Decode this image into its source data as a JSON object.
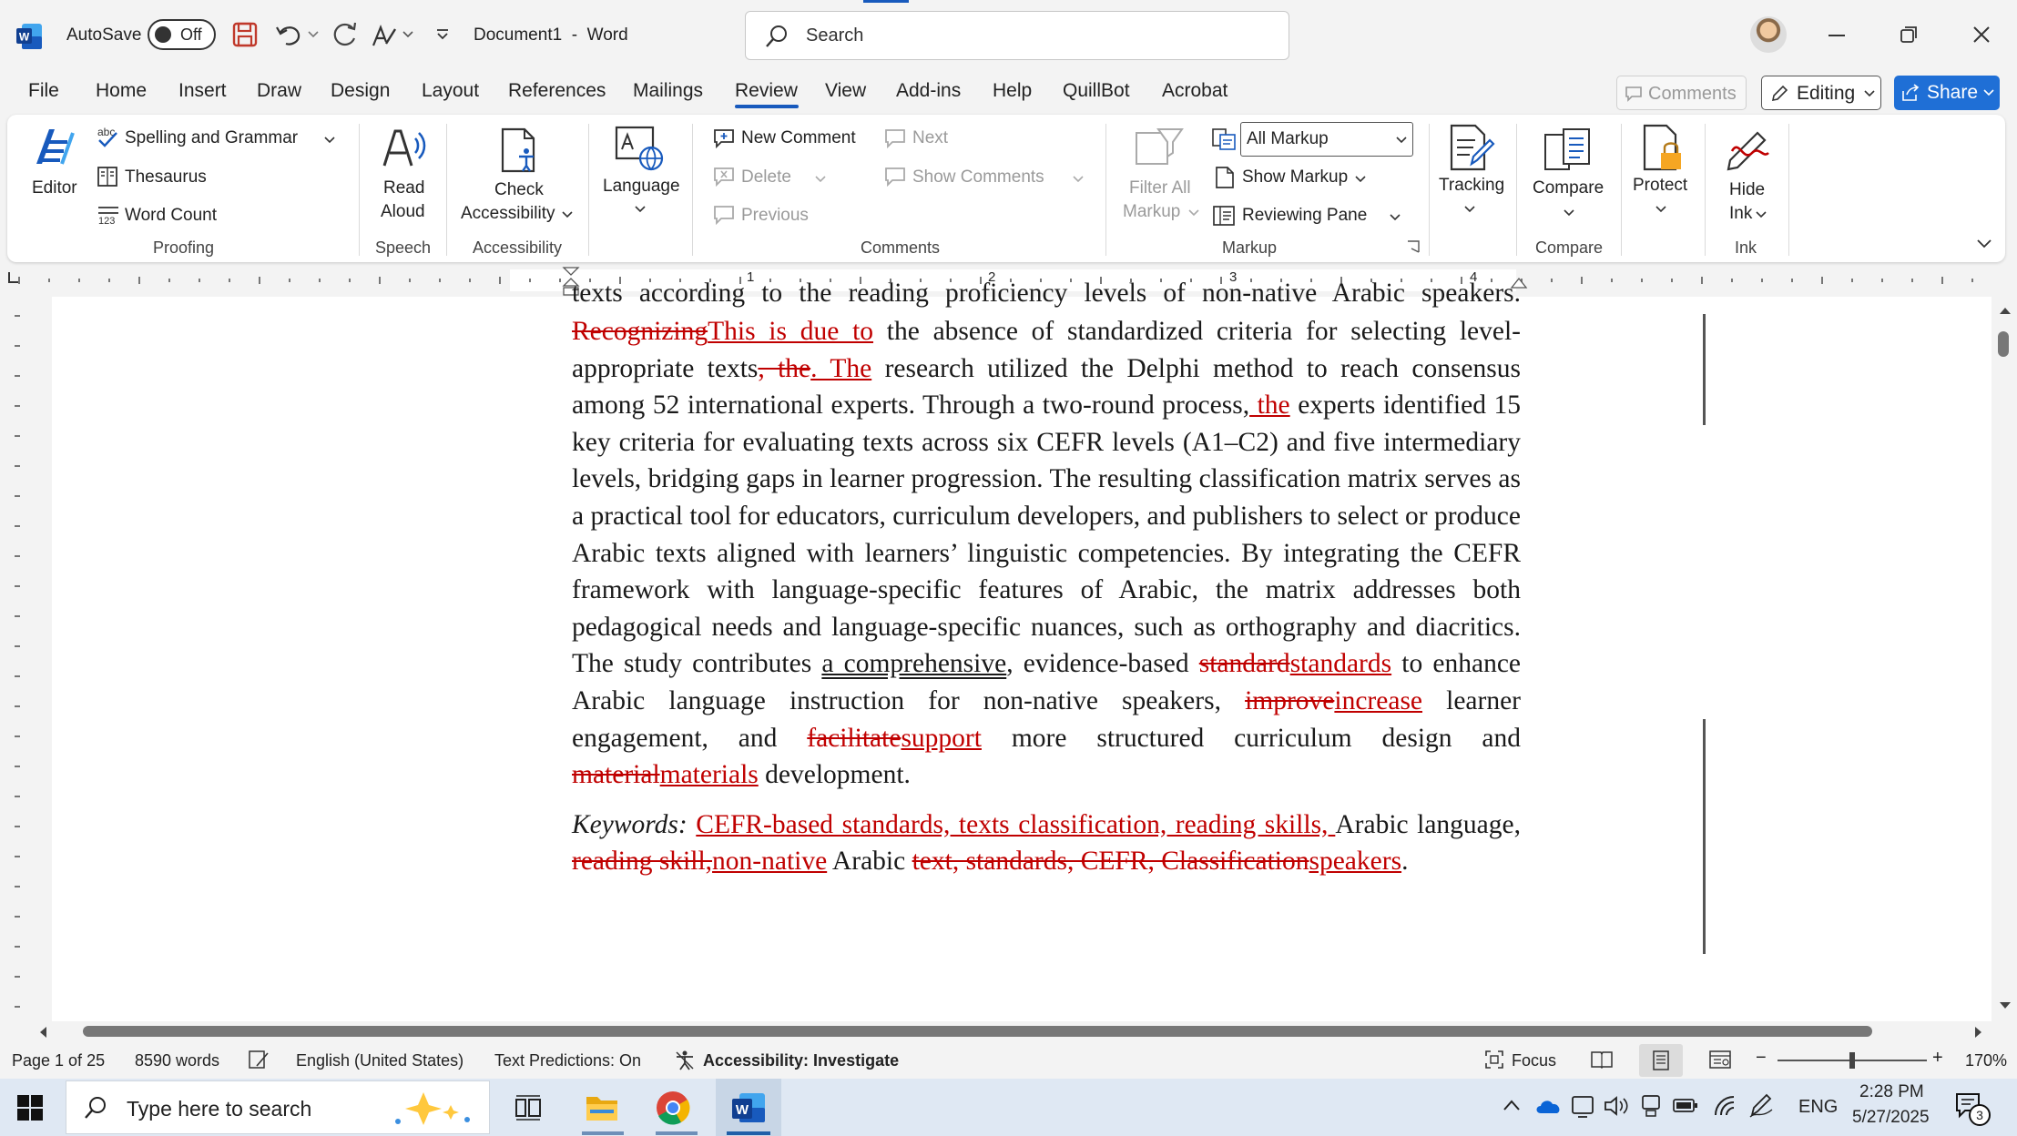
{
  "titlebar": {
    "autosave_label": "AutoSave",
    "autosave_state": "Off",
    "doc_title": "Document1",
    "app_name": "Word",
    "sep": "-",
    "search_placeholder": "Search"
  },
  "tabs": [
    "File",
    "Home",
    "Insert",
    "Draw",
    "Design",
    "Layout",
    "References",
    "Mailings",
    "Review",
    "View",
    "Add-ins",
    "Help",
    "QuillBot",
    "Acrobat"
  ],
  "active_tab": "Review",
  "right_actions": {
    "comments": "Comments",
    "editing": "Editing",
    "share": "Share"
  },
  "ribbon": {
    "proofing": {
      "editor": "Editor",
      "spelling": "Spelling and Grammar",
      "thesaurus": "Thesaurus",
      "word_count": "Word Count",
      "group": "Proofing",
      "abc": "abc",
      "num": "123"
    },
    "speech": {
      "read_aloud_1": "Read",
      "read_aloud_2": "Aloud",
      "group": "Speech"
    },
    "accessibility": {
      "check_1": "Check",
      "check_2": "Accessibility",
      "group": "Accessibility"
    },
    "language": {
      "label": "Language",
      "group": ""
    },
    "comments": {
      "new_comment": "New Comment",
      "delete": "Delete",
      "previous": "Previous",
      "next": "Next",
      "show_comments": "Show Comments",
      "group": "Comments"
    },
    "markup": {
      "filter_1": "Filter All",
      "filter_2": "Markup",
      "all_markup": "All Markup",
      "show_markup": "Show Markup",
      "reviewing_pane": "Reviewing Pane",
      "group": "Markup"
    },
    "tracking": {
      "label": "Tracking"
    },
    "compare": {
      "label": "Compare",
      "group": "Compare"
    },
    "protect": {
      "label": "Protect"
    },
    "ink": {
      "hide_1": "Hide",
      "hide_2": "Ink",
      "group": "Ink"
    }
  },
  "ruler": {
    "numbers": [
      "1",
      "2",
      "3",
      "4"
    ]
  },
  "document": {
    "cut_line": "texts according to the reading proficiency levels of non-native Arabic speakers.",
    "paragraph": [
      {
        "t": "del",
        "v": "Recognizing"
      },
      {
        "t": "ins",
        "v": "This is due to"
      },
      {
        "t": "n",
        "v": " the absence of standardized criteria for selecting level-appropriate texts"
      },
      {
        "t": "del",
        "v": ", the"
      },
      {
        "t": "ins",
        "v": ". The"
      },
      {
        "t": "n",
        "v": " research utilized the Delphi method to reach consensus among 52 international experts. Through a two-round process,"
      },
      {
        "t": "ins",
        "v": " the"
      },
      {
        "t": "n",
        "v": " experts identified 15 key criteria for evaluating texts across six CEFR levels (A1–C2) and five intermediary levels, bridging gaps in learner progression. The resulting classification matrix serves as a practical tool for educators, curriculum developers, and publishers to select or produce Arabic texts aligned with learners’ linguistic competencies. By integrating the CEFR framework with language-specific features of Arabic, the matrix addresses both pedagogical needs and language-specific nuances, such as orthography and diacritics. The study contributes "
      },
      {
        "t": "u",
        "v": "a comprehensive"
      },
      {
        "t": "n",
        "v": ", evidence-based "
      },
      {
        "t": "del",
        "v": "standard"
      },
      {
        "t": "ins",
        "v": "standards"
      },
      {
        "t": "n",
        "v": " to enhance Arabic language instruction for non-native speakers, "
      },
      {
        "t": "del",
        "v": "improve"
      },
      {
        "t": "ins",
        "v": "increase"
      },
      {
        "t": "n",
        "v": " learner engagement, and "
      },
      {
        "t": "del",
        "v": "facilitate"
      },
      {
        "t": "ins",
        "v": "support"
      },
      {
        "t": "n",
        "v": " more structured curriculum design and "
      },
      {
        "t": "del",
        "v": "material"
      },
      {
        "t": "ins",
        "v": "materials"
      },
      {
        "t": "n",
        "v": " development."
      }
    ],
    "keywords": [
      {
        "t": "i",
        "v": "Keywords:"
      },
      {
        "t": "n",
        "v": " "
      },
      {
        "t": "ins",
        "v": "CEFR-based standards, texts classification, reading skills, "
      },
      {
        "t": "n",
        "v": "Arabic language, "
      },
      {
        "t": "del",
        "v": "reading skill,"
      },
      {
        "t": "ins",
        "v": "non-native"
      },
      {
        "t": "n",
        "v": " Arabic "
      },
      {
        "t": "del",
        "v": "text, standards, CEFR, Classification"
      },
      {
        "t": "ins",
        "v": "speakers"
      },
      {
        "t": "n",
        "v": "."
      }
    ]
  },
  "status": {
    "page": "Page 1 of 25",
    "words": "8590 words",
    "language": "English (United States)",
    "predictions": "Text Predictions: On",
    "accessibility": "Accessibility: Investigate",
    "focus": "Focus",
    "zoom": "170%",
    "zoom_minus": "−",
    "zoom_plus": "+",
    "zoom_level": 0.5
  },
  "taskbar": {
    "search_placeholder": "Type here to search",
    "lang": "ENG",
    "time": "2:28 PM",
    "date": "5/27/2025",
    "notif_count": "3"
  },
  "colors": {
    "accent": "#185abd",
    "track": "#c00000",
    "share": "#1f6fd6"
  }
}
